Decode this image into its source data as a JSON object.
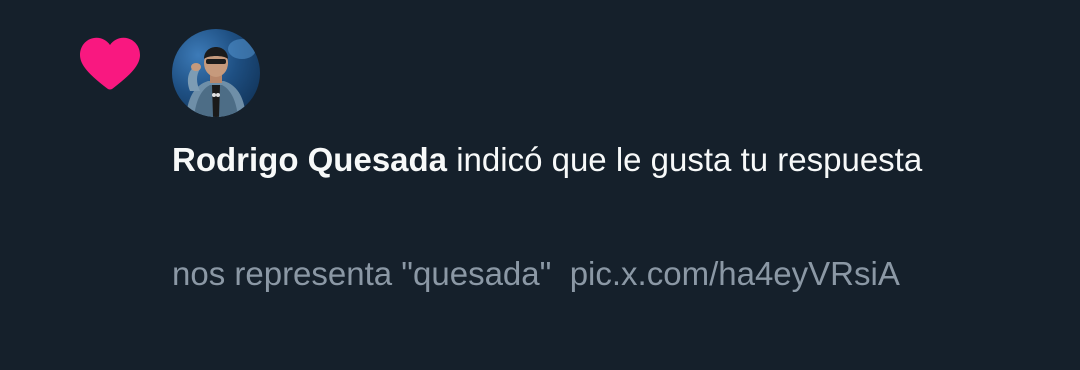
{
  "notification": {
    "icon": "heart-icon",
    "icon_color": "#f91880",
    "user": {
      "name": "Rodrigo Quesada"
    },
    "action_text": " indicó que le gusta tu respuesta",
    "reply": {
      "text": "nos representa \"quesada\"  ",
      "link": "pic.x.com/ha4eyVRsiA"
    }
  },
  "colors": {
    "background": "#15202b",
    "primary_text": "#f7f9f9",
    "secondary_text": "#8b98a5"
  }
}
